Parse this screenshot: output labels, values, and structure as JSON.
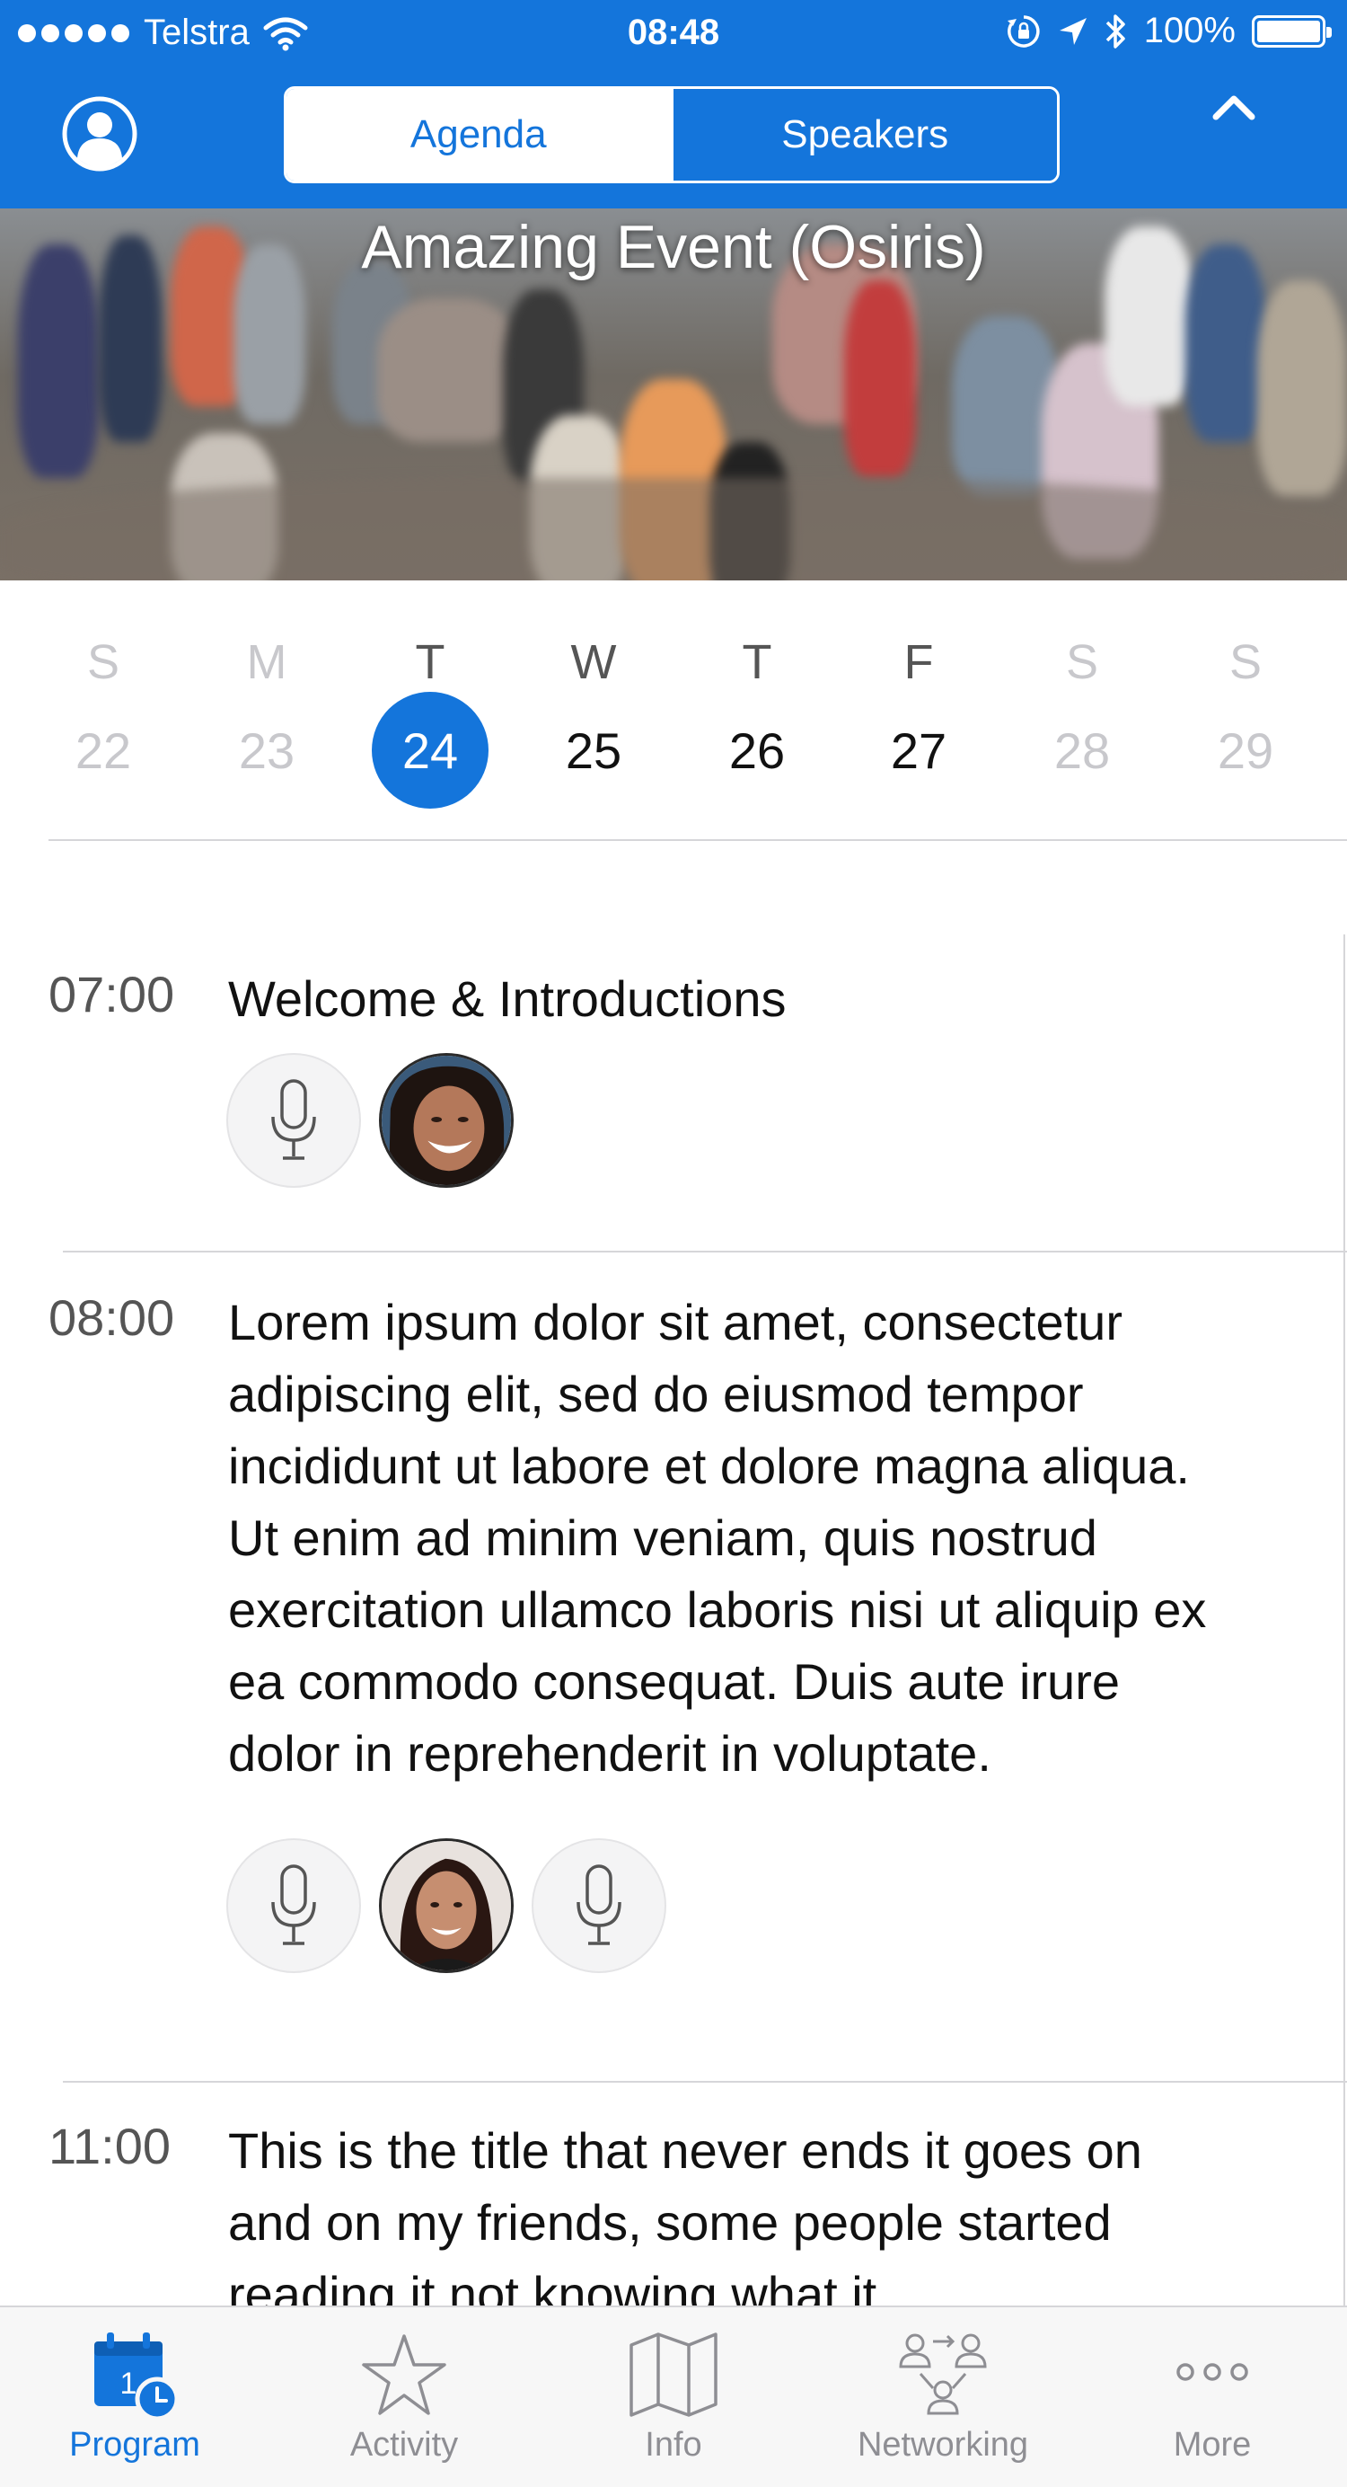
{
  "status_bar": {
    "carrier": "Telstra",
    "time": "08:48",
    "battery": "100%"
  },
  "nav": {
    "segments": [
      {
        "label": "Agenda",
        "active": true
      },
      {
        "label": "Speakers",
        "active": false
      }
    ]
  },
  "event": {
    "title": "Amazing Event (Osiris)"
  },
  "days": [
    {
      "letter": "S",
      "number": "22",
      "state": "dim"
    },
    {
      "letter": "M",
      "number": "23",
      "state": "dim"
    },
    {
      "letter": "T",
      "number": "24",
      "state": "selected"
    },
    {
      "letter": "W",
      "number": "25",
      "state": "enabled"
    },
    {
      "letter": "T",
      "number": "26",
      "state": "enabled"
    },
    {
      "letter": "F",
      "number": "27",
      "state": "enabled"
    },
    {
      "letter": "S",
      "number": "28",
      "state": "dim"
    },
    {
      "letter": "S",
      "number": "29",
      "state": "dim"
    }
  ],
  "sessions": [
    {
      "time": "07:00",
      "title": "Welcome & Introductions",
      "speakers": [
        "microphone-icon",
        "speaker-photo"
      ]
    },
    {
      "time": "08:00",
      "title": "Lorem ipsum dolor sit amet, consectetur adipiscing elit, sed do eiusmod tempor incididunt ut labore et dolore magna aliqua. Ut enim ad minim veniam, quis nostrud exercitation ullamco laboris nisi ut aliquip ex ea commodo consequat. Duis aute irure dolor in reprehenderit in voluptate.",
      "speakers": [
        "microphone-icon",
        "speaker-photo",
        "microphone-icon"
      ]
    },
    {
      "time": "11:00",
      "title": "This is the title that never ends it goes on and on my friends, some people started reading it not knowing what it"
    }
  ],
  "tabs": [
    {
      "label": "Program",
      "icon": "calendar-clock-icon",
      "active": true
    },
    {
      "label": "Activity",
      "icon": "star-icon",
      "active": false
    },
    {
      "label": "Info",
      "icon": "map-icon",
      "active": false
    },
    {
      "label": "Networking",
      "icon": "networking-icon",
      "active": false
    },
    {
      "label": "More",
      "icon": "more-dots-icon",
      "active": false
    }
  ],
  "colors": {
    "accent": "#1475db",
    "dim_text": "#c8c8cc",
    "tab_inactive": "#8e8e93"
  }
}
